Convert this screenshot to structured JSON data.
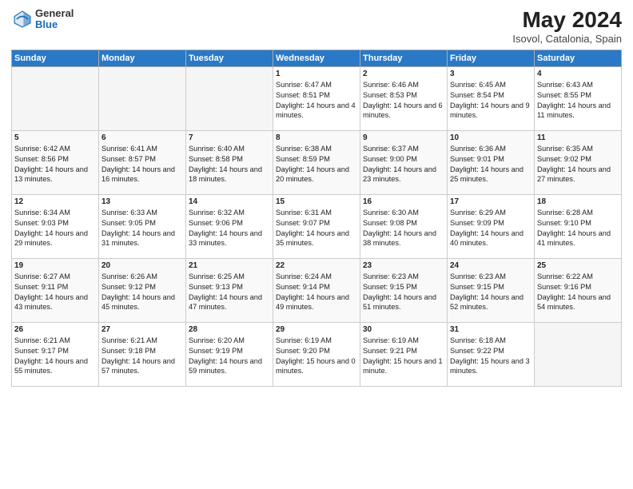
{
  "header": {
    "logo_general": "General",
    "logo_blue": "Blue",
    "month_title": "May 2024",
    "location": "Isovol, Catalonia, Spain"
  },
  "weekdays": [
    "Sunday",
    "Monday",
    "Tuesday",
    "Wednesday",
    "Thursday",
    "Friday",
    "Saturday"
  ],
  "weeks": [
    [
      {
        "day": "",
        "empty": true
      },
      {
        "day": "",
        "empty": true
      },
      {
        "day": "",
        "empty": true
      },
      {
        "day": "1",
        "sunrise": "Sunrise: 6:47 AM",
        "sunset": "Sunset: 8:51 PM",
        "daylight": "Daylight: 14 hours and 4 minutes."
      },
      {
        "day": "2",
        "sunrise": "Sunrise: 6:46 AM",
        "sunset": "Sunset: 8:53 PM",
        "daylight": "Daylight: 14 hours and 6 minutes."
      },
      {
        "day": "3",
        "sunrise": "Sunrise: 6:45 AM",
        "sunset": "Sunset: 8:54 PM",
        "daylight": "Daylight: 14 hours and 9 minutes."
      },
      {
        "day": "4",
        "sunrise": "Sunrise: 6:43 AM",
        "sunset": "Sunset: 8:55 PM",
        "daylight": "Daylight: 14 hours and 11 minutes."
      }
    ],
    [
      {
        "day": "5",
        "sunrise": "Sunrise: 6:42 AM",
        "sunset": "Sunset: 8:56 PM",
        "daylight": "Daylight: 14 hours and 13 minutes."
      },
      {
        "day": "6",
        "sunrise": "Sunrise: 6:41 AM",
        "sunset": "Sunset: 8:57 PM",
        "daylight": "Daylight: 14 hours and 16 minutes."
      },
      {
        "day": "7",
        "sunrise": "Sunrise: 6:40 AM",
        "sunset": "Sunset: 8:58 PM",
        "daylight": "Daylight: 14 hours and 18 minutes."
      },
      {
        "day": "8",
        "sunrise": "Sunrise: 6:38 AM",
        "sunset": "Sunset: 8:59 PM",
        "daylight": "Daylight: 14 hours and 20 minutes."
      },
      {
        "day": "9",
        "sunrise": "Sunrise: 6:37 AM",
        "sunset": "Sunset: 9:00 PM",
        "daylight": "Daylight: 14 hours and 23 minutes."
      },
      {
        "day": "10",
        "sunrise": "Sunrise: 6:36 AM",
        "sunset": "Sunset: 9:01 PM",
        "daylight": "Daylight: 14 hours and 25 minutes."
      },
      {
        "day": "11",
        "sunrise": "Sunrise: 6:35 AM",
        "sunset": "Sunset: 9:02 PM",
        "daylight": "Daylight: 14 hours and 27 minutes."
      }
    ],
    [
      {
        "day": "12",
        "sunrise": "Sunrise: 6:34 AM",
        "sunset": "Sunset: 9:03 PM",
        "daylight": "Daylight: 14 hours and 29 minutes."
      },
      {
        "day": "13",
        "sunrise": "Sunrise: 6:33 AM",
        "sunset": "Sunset: 9:05 PM",
        "daylight": "Daylight: 14 hours and 31 minutes."
      },
      {
        "day": "14",
        "sunrise": "Sunrise: 6:32 AM",
        "sunset": "Sunset: 9:06 PM",
        "daylight": "Daylight: 14 hours and 33 minutes."
      },
      {
        "day": "15",
        "sunrise": "Sunrise: 6:31 AM",
        "sunset": "Sunset: 9:07 PM",
        "daylight": "Daylight: 14 hours and 35 minutes."
      },
      {
        "day": "16",
        "sunrise": "Sunrise: 6:30 AM",
        "sunset": "Sunset: 9:08 PM",
        "daylight": "Daylight: 14 hours and 38 minutes."
      },
      {
        "day": "17",
        "sunrise": "Sunrise: 6:29 AM",
        "sunset": "Sunset: 9:09 PM",
        "daylight": "Daylight: 14 hours and 40 minutes."
      },
      {
        "day": "18",
        "sunrise": "Sunrise: 6:28 AM",
        "sunset": "Sunset: 9:10 PM",
        "daylight": "Daylight: 14 hours and 41 minutes."
      }
    ],
    [
      {
        "day": "19",
        "sunrise": "Sunrise: 6:27 AM",
        "sunset": "Sunset: 9:11 PM",
        "daylight": "Daylight: 14 hours and 43 minutes."
      },
      {
        "day": "20",
        "sunrise": "Sunrise: 6:26 AM",
        "sunset": "Sunset: 9:12 PM",
        "daylight": "Daylight: 14 hours and 45 minutes."
      },
      {
        "day": "21",
        "sunrise": "Sunrise: 6:25 AM",
        "sunset": "Sunset: 9:13 PM",
        "daylight": "Daylight: 14 hours and 47 minutes."
      },
      {
        "day": "22",
        "sunrise": "Sunrise: 6:24 AM",
        "sunset": "Sunset: 9:14 PM",
        "daylight": "Daylight: 14 hours and 49 minutes."
      },
      {
        "day": "23",
        "sunrise": "Sunrise: 6:23 AM",
        "sunset": "Sunset: 9:15 PM",
        "daylight": "Daylight: 14 hours and 51 minutes."
      },
      {
        "day": "24",
        "sunrise": "Sunrise: 6:23 AM",
        "sunset": "Sunset: 9:15 PM",
        "daylight": "Daylight: 14 hours and 52 minutes."
      },
      {
        "day": "25",
        "sunrise": "Sunrise: 6:22 AM",
        "sunset": "Sunset: 9:16 PM",
        "daylight": "Daylight: 14 hours and 54 minutes."
      }
    ],
    [
      {
        "day": "26",
        "sunrise": "Sunrise: 6:21 AM",
        "sunset": "Sunset: 9:17 PM",
        "daylight": "Daylight: 14 hours and 55 minutes."
      },
      {
        "day": "27",
        "sunrise": "Sunrise: 6:21 AM",
        "sunset": "Sunset: 9:18 PM",
        "daylight": "Daylight: 14 hours and 57 minutes."
      },
      {
        "day": "28",
        "sunrise": "Sunrise: 6:20 AM",
        "sunset": "Sunset: 9:19 PM",
        "daylight": "Daylight: 14 hours and 59 minutes."
      },
      {
        "day": "29",
        "sunrise": "Sunrise: 6:19 AM",
        "sunset": "Sunset: 9:20 PM",
        "daylight": "Daylight: 15 hours and 0 minutes."
      },
      {
        "day": "30",
        "sunrise": "Sunrise: 6:19 AM",
        "sunset": "Sunset: 9:21 PM",
        "daylight": "Daylight: 15 hours and 1 minute."
      },
      {
        "day": "31",
        "sunrise": "Sunrise: 6:18 AM",
        "sunset": "Sunset: 9:22 PM",
        "daylight": "Daylight: 15 hours and 3 minutes."
      },
      {
        "day": "",
        "empty": true
      }
    ]
  ]
}
